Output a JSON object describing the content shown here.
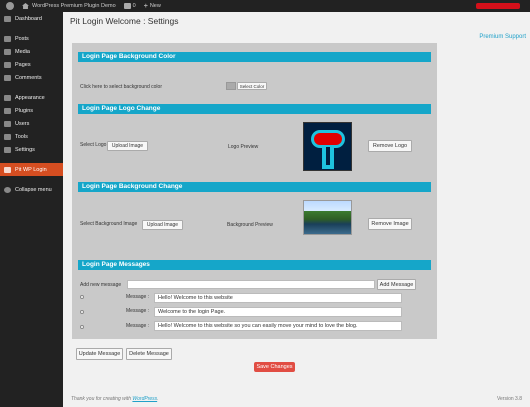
{
  "adminbar": {
    "site_name": "WordPress Premium Plugin Demo",
    "comments_count": "0",
    "new_label": "New"
  },
  "sidebar": {
    "items": [
      {
        "label": "Dashboard",
        "icon": "dashboard-icon"
      },
      {
        "label": "Posts",
        "icon": "pin-icon"
      },
      {
        "label": "Media",
        "icon": "media-icon"
      },
      {
        "label": "Pages",
        "icon": "page-icon"
      },
      {
        "label": "Comments",
        "icon": "comment-icon"
      },
      {
        "label": "Appearance",
        "icon": "brush-icon"
      },
      {
        "label": "Plugins",
        "icon": "plug-icon"
      },
      {
        "label": "Users",
        "icon": "users-icon"
      },
      {
        "label": "Tools",
        "icon": "wrench-icon"
      },
      {
        "label": "Settings",
        "icon": "settings-icon"
      },
      {
        "label": "Pit WP Login",
        "icon": "plugin-icon"
      },
      {
        "label": "Collapse menu",
        "icon": "collapse-icon"
      }
    ]
  },
  "page": {
    "title": "Pit Login Welcome : Settings",
    "premium_link": "Premium Support"
  },
  "bg_color": {
    "heading": "Login Page Background Color",
    "label": "Click here to select background color",
    "button": "Select Color"
  },
  "logo": {
    "heading": "Login Page Logo Change",
    "select_label": "Select Logo",
    "upload_button": "Upload Image",
    "preview_label": "Logo Preview",
    "remove_button": "Remove Logo"
  },
  "bg_image": {
    "heading": "Login Page Background Change",
    "select_label": "Select Background Image",
    "upload_button": "Upload Image",
    "preview_label": "Background Preview",
    "remove_button": "Remove Image"
  },
  "messages": {
    "heading": "Login Page Messages",
    "add_label": "Add new message",
    "add_value": "",
    "add_button": "Add Message",
    "message_label": "Message :",
    "items": [
      "Hello! Welcome to this website",
      "Welcome to the login Page.",
      "Hello! Welcome to this website so you can easily move your mind to love the blog."
    ]
  },
  "actions": {
    "update_button": "Update Message",
    "delete_button": "Delete Message",
    "save_button": "Save Changes"
  },
  "footer": {
    "thanks_prefix": "Thank you for creating with ",
    "thanks_link": "WordPress",
    "thanks_suffix": ".",
    "version": "Version 3.8"
  },
  "colors": {
    "accent": "#15a6c9",
    "active_menu": "#d54e21",
    "save_button": "#e14d43"
  }
}
